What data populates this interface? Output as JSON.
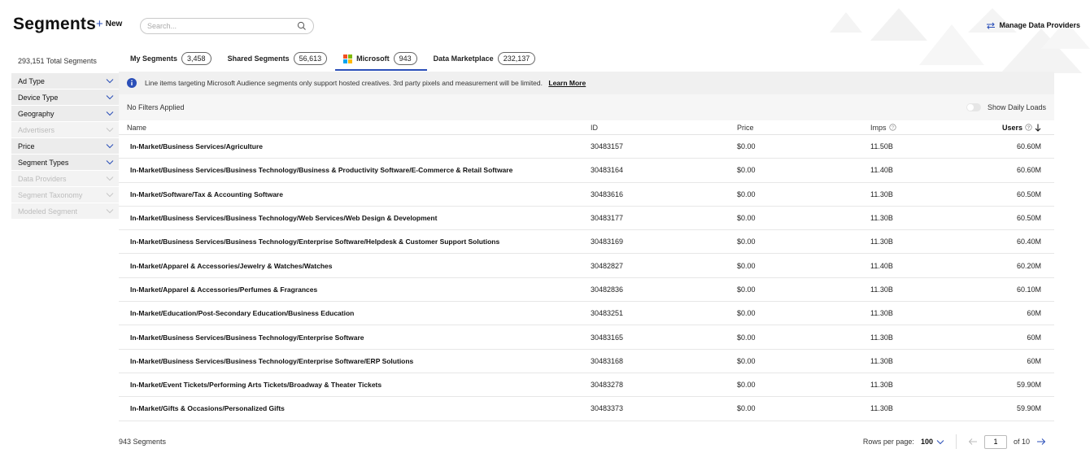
{
  "header": {
    "title": "Segments",
    "new_label": "New",
    "search_placeholder": "Search...",
    "manage_label": "Manage Data Providers"
  },
  "sidebar": {
    "total": "293,151 Total Segments",
    "filters": [
      {
        "label": "Ad Type",
        "enabled": true
      },
      {
        "label": "Device Type",
        "enabled": true
      },
      {
        "label": "Geography",
        "enabled": true
      },
      {
        "label": "Advertisers",
        "enabled": false
      },
      {
        "label": "Price",
        "enabled": true
      },
      {
        "label": "Segment Types",
        "enabled": true
      },
      {
        "label": "Data Providers",
        "enabled": false
      },
      {
        "label": "Segment Taxonomy",
        "enabled": false
      },
      {
        "label": "Modeled Segment",
        "enabled": false
      }
    ]
  },
  "tabs": [
    {
      "label": "My Segments",
      "count": "3,458"
    },
    {
      "label": "Shared Segments",
      "count": "56,613"
    },
    {
      "label": "Microsoft",
      "count": "943",
      "active": true
    },
    {
      "label": "Data Marketplace",
      "count": "232,137"
    }
  ],
  "banner": {
    "text": "Line items targeting Microsoft Audience segments only support hosted creatives. 3rd party pixels and measurement will be limited.",
    "link": "Learn More"
  },
  "filterbar": {
    "status": "No Filters Applied",
    "toggle_label": "Show Daily Loads"
  },
  "table": {
    "columns": {
      "name": "Name",
      "id": "ID",
      "price": "Price",
      "imps": "Imps",
      "users": "Users"
    },
    "rows": [
      {
        "name": "In-Market/Business Services/Agriculture",
        "id": "30483157",
        "price": "$0.00",
        "imps": "11.50B",
        "users": "60.60M"
      },
      {
        "name": "In-Market/Business Services/Business Technology/Business & Productivity Software/E-Commerce & Retail Software",
        "id": "30483164",
        "price": "$0.00",
        "imps": "11.40B",
        "users": "60.60M"
      },
      {
        "name": "In-Market/Software/Tax & Accounting Software",
        "id": "30483616",
        "price": "$0.00",
        "imps": "11.30B",
        "users": "60.50M"
      },
      {
        "name": "In-Market/Business Services/Business Technology/Web Services/Web Design & Development",
        "id": "30483177",
        "price": "$0.00",
        "imps": "11.30B",
        "users": "60.50M"
      },
      {
        "name": "In-Market/Business Services/Business Technology/Enterprise Software/Helpdesk & Customer Support Solutions",
        "id": "30483169",
        "price": "$0.00",
        "imps": "11.30B",
        "users": "60.40M"
      },
      {
        "name": "In-Market/Apparel & Accessories/Jewelry & Watches/Watches",
        "id": "30482827",
        "price": "$0.00",
        "imps": "11.40B",
        "users": "60.20M"
      },
      {
        "name": "In-Market/Apparel & Accessories/Perfumes & Fragrances",
        "id": "30482836",
        "price": "$0.00",
        "imps": "11.30B",
        "users": "60.10M"
      },
      {
        "name": "In-Market/Education/Post-Secondary Education/Business Education",
        "id": "30483251",
        "price": "$0.00",
        "imps": "11.30B",
        "users": "60M"
      },
      {
        "name": "In-Market/Business Services/Business Technology/Enterprise Software",
        "id": "30483165",
        "price": "$0.00",
        "imps": "11.30B",
        "users": "60M"
      },
      {
        "name": "In-Market/Business Services/Business Technology/Enterprise Software/ERP Solutions",
        "id": "30483168",
        "price": "$0.00",
        "imps": "11.30B",
        "users": "60M"
      },
      {
        "name": "In-Market/Event Tickets/Performing Arts Tickets/Broadway & Theater Tickets",
        "id": "30483278",
        "price": "$0.00",
        "imps": "11.30B",
        "users": "59.90M"
      },
      {
        "name": "In-Market/Gifts & Occasions/Personalized Gifts",
        "id": "30483373",
        "price": "$0.00",
        "imps": "11.30B",
        "users": "59.90M"
      }
    ]
  },
  "footer": {
    "count": "943 Segments",
    "rows_per_page_label": "Rows per page:",
    "rows_per_page": "100",
    "page": "1",
    "of_pages": "of 10"
  },
  "colors": {
    "accent": "#2b4fb8",
    "ms_red": "#f25022",
    "ms_green": "#7fba00",
    "ms_blue": "#00a4ef",
    "ms_yellow": "#ffb900"
  }
}
